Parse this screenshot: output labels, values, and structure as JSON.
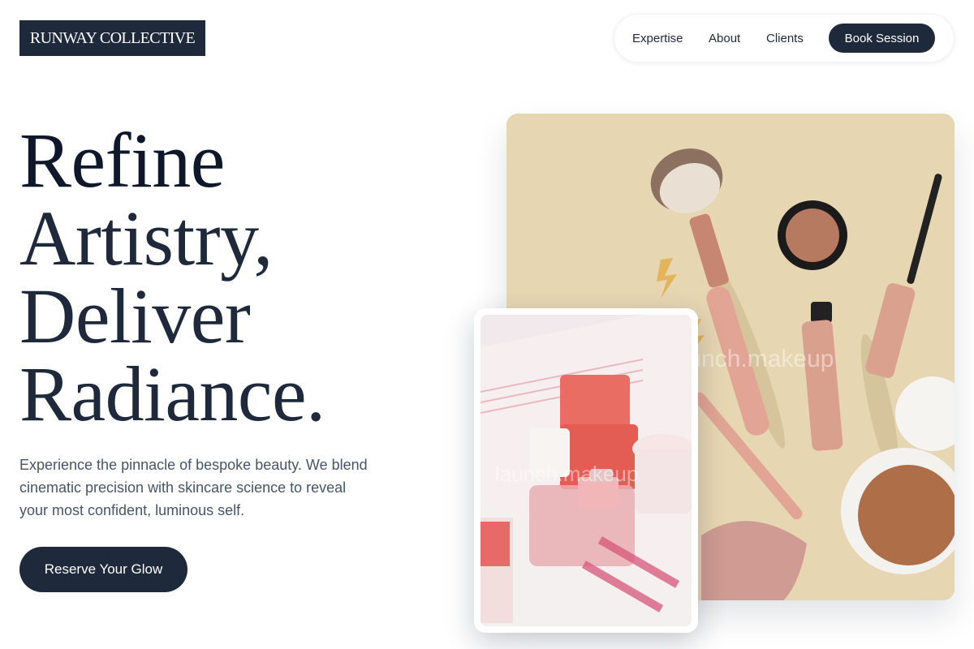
{
  "brand": {
    "logo_text": "RUNWAY COLLECTIVE"
  },
  "nav": {
    "links": [
      {
        "label": "Expertise"
      },
      {
        "label": "About"
      },
      {
        "label": "Clients"
      }
    ],
    "cta_label": "Book Session"
  },
  "hero": {
    "title_lines": [
      "Refine",
      "Artistry,",
      "Deliver",
      "Radiance."
    ],
    "subtitle": "Experience the pinnacle of bespoke beauty. We blend cinematic precision with skincare science to reveal your most confident, luminous self.",
    "cta_label": "Reserve Your Glow"
  },
  "images": {
    "main": {
      "subject": "flat lay of makeup brushes, mascara, lip gloss, compact powder and pot of blush on beige background",
      "watermark": "launch.makeup"
    },
    "inset": {
      "subject": "beauty box with coral cosmetic jars and perfume bottle",
      "watermark": "launch.makeup"
    }
  },
  "colors": {
    "primary": "#1e293b",
    "text_muted": "#475569",
    "image_bg": "#e6d6b2",
    "accent_rose": "#d99a8c"
  }
}
